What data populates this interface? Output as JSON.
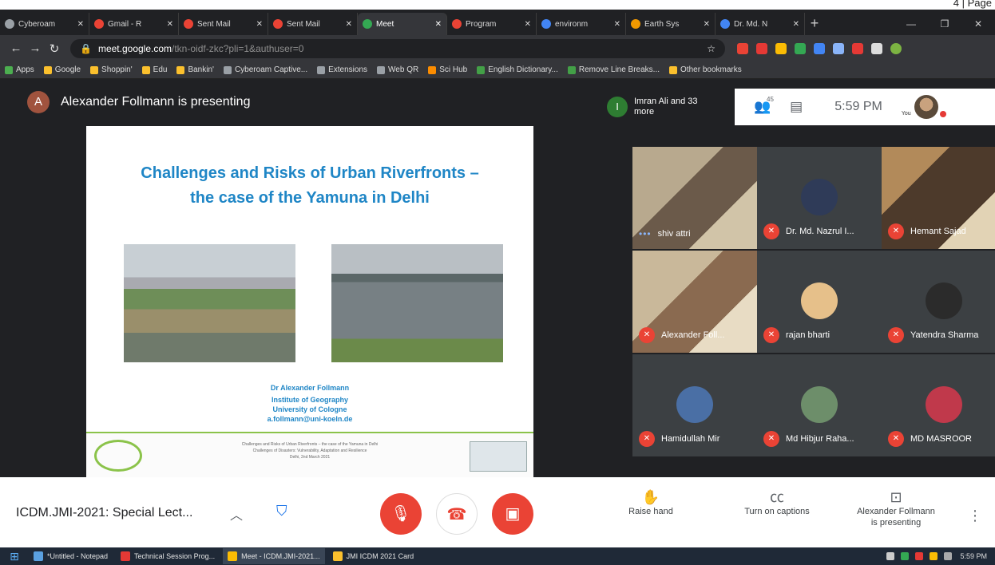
{
  "page_tag": "4 | Page",
  "browser": {
    "tabs": [
      {
        "label": "Cyberoam",
        "color": "#9aa0a6",
        "active": false
      },
      {
        "label": "Gmail - R",
        "color": "#ea4335",
        "active": false
      },
      {
        "label": "Sent Mail",
        "color": "#ea4335",
        "active": false
      },
      {
        "label": "Sent Mail",
        "color": "#ea4335",
        "active": false
      },
      {
        "label": "Meet",
        "color": "#34a853",
        "active": true
      },
      {
        "label": "Program",
        "color": "#ea4335",
        "active": false
      },
      {
        "label": "environm",
        "color": "#4285f4",
        "active": false
      },
      {
        "label": "Earth Sys",
        "color": "#f29900",
        "active": false
      },
      {
        "label": "Dr. Md. N",
        "color": "#4285f4",
        "active": false
      }
    ],
    "new_tab": "+",
    "url_host": "meet.google.com",
    "url_rest": "/tkn-oidf-zkc?pli=1&authuser=0",
    "bookmarks": [
      {
        "label": "Apps",
        "color": "#4caf50"
      },
      {
        "label": "Google",
        "color": "#fbc02d"
      },
      {
        "label": "Shoppin'",
        "color": "#fbc02d"
      },
      {
        "label": "Edu",
        "color": "#fbc02d"
      },
      {
        "label": "Bankin'",
        "color": "#fbc02d"
      },
      {
        "label": "Cyberoam Captive...",
        "color": "#9aa0a6"
      },
      {
        "label": "Extensions",
        "color": "#9aa0a6"
      },
      {
        "label": "Web QR",
        "color": "#9aa0a6"
      },
      {
        "label": "Sci Hub",
        "color": "#fb8c00"
      },
      {
        "label": "English Dictionary...",
        "color": "#43a047"
      },
      {
        "label": "Remove Line Breaks...",
        "color": "#43a047"
      },
      {
        "label": "Other bookmarks",
        "color": "#fbc02d"
      }
    ]
  },
  "meet": {
    "presenter_initial": "A",
    "presenting_text": "Alexander Follmann is presenting",
    "people_initial": "I",
    "people_text": "Imran Ali and 33 more",
    "people_count": "45",
    "clock": "5:59 PM",
    "you_label": "You",
    "slide": {
      "title_line1": "Challenges and Risks of Urban Riverfronts –",
      "title_line2": "the case of the Yamuna in Delhi",
      "author": "Dr Alexander Follmann",
      "institute": "Institute of Geography",
      "university": "University of Cologne",
      "email": "a.follmann@uni-koeln.de",
      "footer_line1": "Challenges and Risks of Urban Riverfronts – the case of the Yamuna in Delhi",
      "footer_line2": "Challenges of Disasters: Vulnerability, Adaptation and Resilience",
      "footer_line3": "Delhi, 2nd March 2021"
    },
    "participants": [
      {
        "name": "shiv attri",
        "muted": false,
        "video": true
      },
      {
        "name": "Dr. Md. Nazrul I...",
        "muted": true,
        "video": false
      },
      {
        "name": "Hemant Sajad",
        "muted": true,
        "video": true
      },
      {
        "name": "Alexander Foll...",
        "muted": true,
        "video": true
      },
      {
        "name": "rajan bharti",
        "muted": true,
        "video": false
      },
      {
        "name": "Yatendra Sharma",
        "muted": true,
        "video": false
      },
      {
        "name": "Hamidullah Mir",
        "muted": true,
        "video": false
      },
      {
        "name": "Md Hibjur Raha...",
        "muted": true,
        "video": false
      },
      {
        "name": "MD MASROOR",
        "muted": true,
        "video": false
      }
    ],
    "meeting_title": "ICDM.JMI-2021: Special Lect...",
    "raise_hand": "Raise hand",
    "captions": "Turn on captions",
    "presenting_line1": "Alexander Follmann",
    "presenting_line2": "is presenting"
  },
  "taskbar": {
    "items": [
      {
        "label": "*Untitled - Notepad",
        "color": "#5aa0e0",
        "on": false
      },
      {
        "label": "Technical Session Prog...",
        "color": "#e53935",
        "on": false
      },
      {
        "label": "Meet - ICDM.JMI-2021...",
        "color": "#fbbc04",
        "on": true
      },
      {
        "label": "JMI ICDM 2021 Card",
        "color": "#fbc02d",
        "on": false
      }
    ],
    "time": "5:59 PM"
  }
}
